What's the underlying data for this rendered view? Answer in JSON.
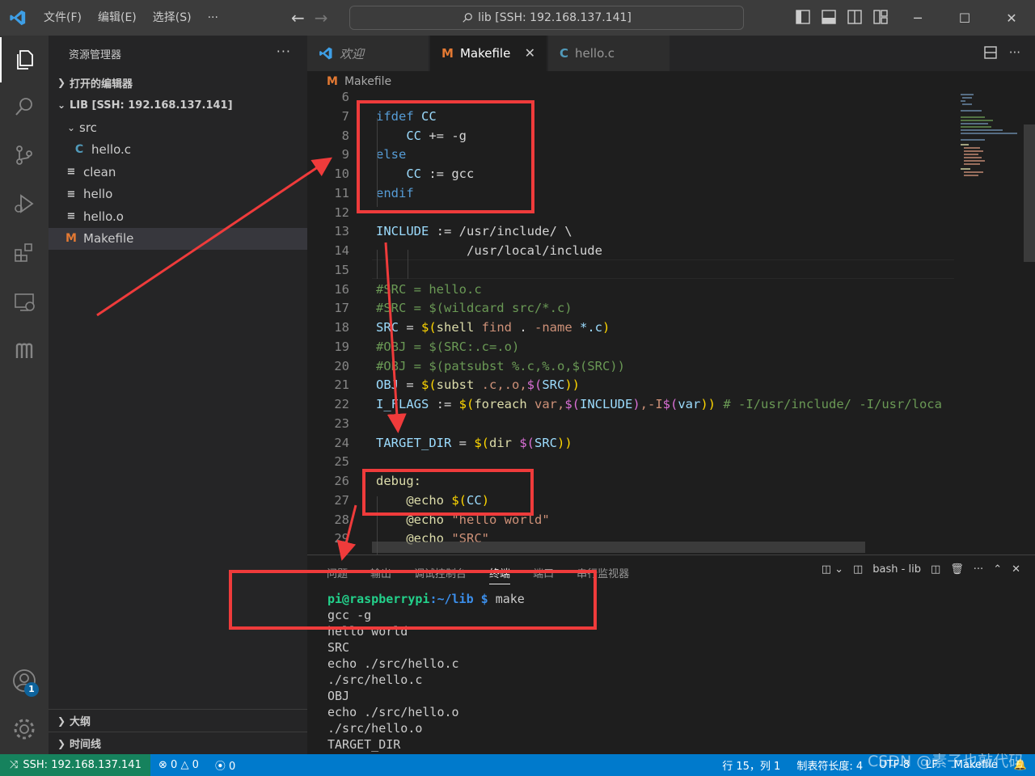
{
  "titlebar": {
    "menu": [
      "文件(F)",
      "编辑(E)",
      "选择(S)"
    ],
    "more": "···",
    "search_text": "lib [SSH: 192.168.137.141]"
  },
  "activity_icons": [
    "explorer-icon",
    "search-icon",
    "source-control-icon",
    "run-debug-icon",
    "extensions-icon",
    "remote-explorer-icon",
    "m-extension-icon",
    "accounts-icon",
    "manage-gear-icon"
  ],
  "accounts_badge": "1",
  "sidebar": {
    "title": "资源管理器",
    "more": "···",
    "open_editors": "打开的编辑器",
    "workspace": "LIB [SSH: 192.168.137.141]",
    "tree": [
      {
        "label": "src",
        "type": "folder",
        "icon": "chevron-down-icon"
      },
      {
        "label": "hello.c",
        "type": "c",
        "icon_text": "C"
      },
      {
        "label": "clean",
        "type": "file",
        "icon_text": "≡"
      },
      {
        "label": "hello",
        "type": "file",
        "icon_text": "≡"
      },
      {
        "label": "hello.o",
        "type": "file",
        "icon_text": "≡"
      },
      {
        "label": "Makefile",
        "type": "makefile",
        "icon_text": "M"
      }
    ],
    "outline": "大纲",
    "timeline": "时间线"
  },
  "tabs": [
    {
      "label": "欢迎",
      "icon": "vscode-logo-icon"
    },
    {
      "label": "Makefile",
      "icon_text": "M",
      "close": "✕"
    },
    {
      "label": "hello.c",
      "icon_text": "C"
    }
  ],
  "breadcrumb": {
    "icon_text": "M",
    "label": "Makefile"
  },
  "code_lines": [
    {
      "n": "6",
      "tokens": []
    },
    {
      "n": "7",
      "tokens": [
        [
          "ifdef ",
          "kw"
        ],
        [
          "CC",
          "var"
        ]
      ]
    },
    {
      "n": "8",
      "tokens": [
        [
          "    ",
          "op"
        ],
        [
          "CC",
          "var"
        ],
        [
          " += -g",
          "op"
        ]
      ]
    },
    {
      "n": "9",
      "tokens": [
        [
          "else",
          "kw"
        ]
      ]
    },
    {
      "n": "10",
      "tokens": [
        [
          "    ",
          "op"
        ],
        [
          "CC",
          "var"
        ],
        [
          " := gcc",
          "op"
        ]
      ]
    },
    {
      "n": "11",
      "tokens": [
        [
          "endif",
          "kw"
        ]
      ]
    },
    {
      "n": "12",
      "tokens": []
    },
    {
      "n": "13",
      "tokens": [
        [
          "INCLUDE",
          "var"
        ],
        [
          " := /usr/include/ \\",
          "op"
        ]
      ]
    },
    {
      "n": "14",
      "tokens": [
        [
          "            /usr/local/include",
          "op"
        ]
      ]
    },
    {
      "n": "15",
      "tokens": []
    },
    {
      "n": "16",
      "tokens": [
        [
          "#SRC = hello.c",
          "cm"
        ]
      ]
    },
    {
      "n": "17",
      "tokens": [
        [
          "#SRC = $(wildcard src/*.c)",
          "cm"
        ]
      ]
    },
    {
      "n": "18",
      "tokens": [
        [
          "SRC",
          "var"
        ],
        [
          " = ",
          "op"
        ],
        [
          "$(",
          "br1"
        ],
        [
          "shell",
          "fn"
        ],
        [
          " find",
          "str"
        ],
        [
          " . ",
          "op"
        ],
        [
          "-name ",
          "str"
        ],
        [
          "*.c",
          "var"
        ],
        [
          ")",
          "br1"
        ]
      ]
    },
    {
      "n": "19",
      "tokens": [
        [
          "#OBJ = $(SRC:.c=.o)",
          "cm"
        ]
      ]
    },
    {
      "n": "20",
      "tokens": [
        [
          "#OBJ = $(patsubst %.c,%.o,$(SRC))",
          "cm"
        ]
      ]
    },
    {
      "n": "21",
      "tokens": [
        [
          "OBJ",
          "var"
        ],
        [
          " = ",
          "op"
        ],
        [
          "$(",
          "br1"
        ],
        [
          "subst",
          "fn"
        ],
        [
          " .c,.o,",
          "str"
        ],
        [
          "$(",
          "br2"
        ],
        [
          "SRC",
          "var"
        ],
        [
          "))",
          "br1"
        ]
      ]
    },
    {
      "n": "22",
      "tokens": [
        [
          "I_FLAGS",
          "var"
        ],
        [
          " := ",
          "op"
        ],
        [
          "$(",
          "br1"
        ],
        [
          "foreach",
          "fn"
        ],
        [
          " var,",
          "str"
        ],
        [
          "$(",
          "br2"
        ],
        [
          "INCLUDE",
          "var"
        ],
        [
          ")",
          "br2"
        ],
        [
          ",-I",
          "str"
        ],
        [
          "$(",
          "br2"
        ],
        [
          "var",
          "var"
        ],
        [
          "))",
          "br1"
        ],
        [
          " # -I/usr/include/ -I/usr/loca",
          "cm"
        ]
      ]
    },
    {
      "n": "23",
      "tokens": []
    },
    {
      "n": "24",
      "tokens": [
        [
          "TARGET_DIR",
          "var"
        ],
        [
          " = ",
          "op"
        ],
        [
          "$(",
          "br1"
        ],
        [
          "dir",
          "fn"
        ],
        [
          " ",
          "op"
        ],
        [
          "$(",
          "br2"
        ],
        [
          "SRC",
          "var"
        ],
        [
          "))",
          "br1"
        ]
      ]
    },
    {
      "n": "25",
      "tokens": []
    },
    {
      "n": "26",
      "tokens": [
        [
          "debug:",
          "fn"
        ]
      ]
    },
    {
      "n": "27",
      "tokens": [
        [
          "    ",
          "op"
        ],
        [
          "@echo",
          "fn"
        ],
        [
          " ",
          "op"
        ],
        [
          "$(",
          "br1"
        ],
        [
          "CC",
          "var"
        ],
        [
          ")",
          "br1"
        ]
      ]
    },
    {
      "n": "28",
      "tokens": [
        [
          "    ",
          "op"
        ],
        [
          "@echo",
          "fn"
        ],
        [
          " \"hello world\"",
          "str"
        ]
      ]
    },
    {
      "n": "29",
      "tokens": [
        [
          "    ",
          "op"
        ],
        [
          "@echo",
          "fn"
        ],
        [
          " \"SRC\"",
          "str"
        ]
      ]
    }
  ],
  "panel": {
    "tabs": [
      "问题",
      "输出",
      "调试控制台",
      "终端",
      "端口",
      "串行监视器"
    ],
    "active_tab": "终端",
    "terminal_name": "bash - lib",
    "prompt_user": "pi@raspberrypi",
    "prompt_path": ":~/lib $",
    "command": "make",
    "output": [
      "gcc -g",
      "hello world",
      "SRC",
      "echo ./src/hello.c",
      "./src/hello.c",
      "OBJ",
      "echo ./src/hello.o",
      "./src/hello.o",
      "TARGET_DIR"
    ]
  },
  "statusbar": {
    "remote": "SSH: 192.168.137.141",
    "errors": "0",
    "warnings": "0",
    "ports": "0",
    "position": "行 15，列 1",
    "tab_size": "制表符长度: 4",
    "encoding": "UTF-8",
    "eol": "LF",
    "language": "Makefile"
  },
  "watermark": "CSDN @素子也敲代码",
  "colors": {
    "annotation": "#ef3b3b",
    "accent": "#007acc",
    "remote": "#16825d"
  }
}
